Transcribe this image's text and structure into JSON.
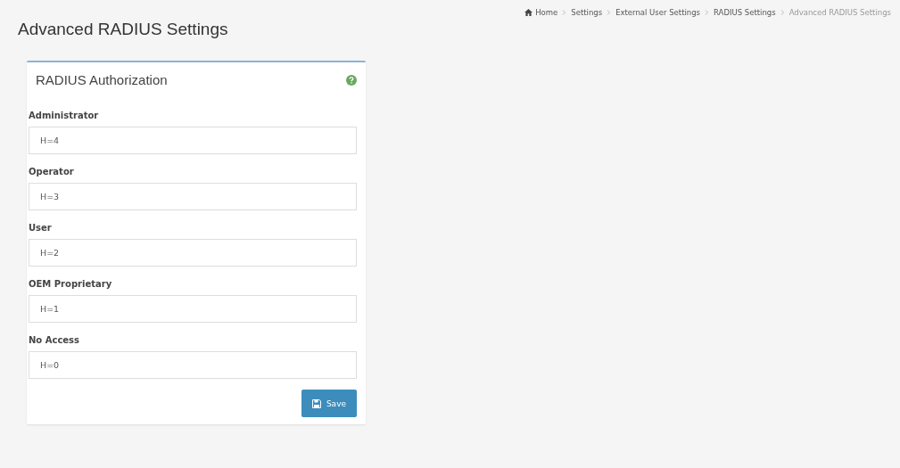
{
  "page_title": "Advanced RADIUS Settings",
  "breadcrumb": [
    {
      "label": "Home",
      "kind": "home"
    },
    {
      "label": "Settings",
      "kind": "link"
    },
    {
      "label": "External User Settings",
      "kind": "link"
    },
    {
      "label": "RADIUS Settings",
      "kind": "link"
    },
    {
      "label": "Advanced RADIUS Settings",
      "kind": "current"
    }
  ],
  "panel": {
    "title": "RADIUS Authorization",
    "fields": [
      {
        "label": "Administrator",
        "value": "H=4"
      },
      {
        "label": "Operator",
        "value": "H=3"
      },
      {
        "label": "User",
        "value": "H=2"
      },
      {
        "label": "OEM Proprietary",
        "value": "H=1"
      },
      {
        "label": "No Access",
        "value": "H=0"
      }
    ],
    "save_button": "Save"
  }
}
